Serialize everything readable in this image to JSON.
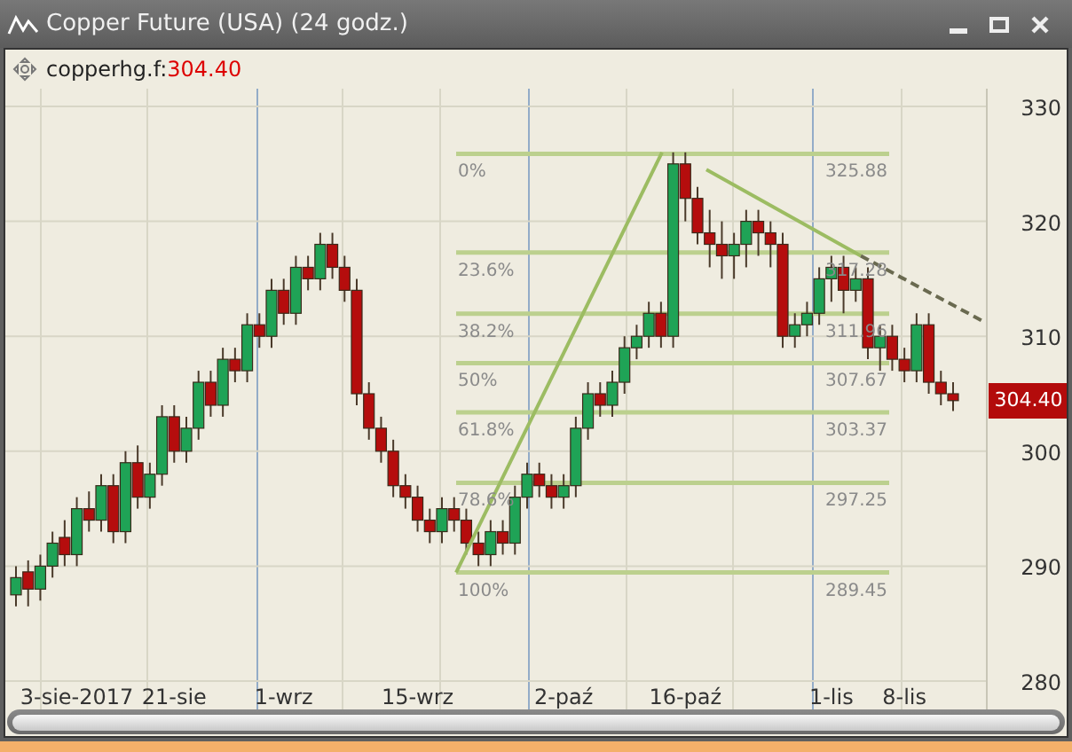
{
  "window": {
    "title": "Copper Future (USA) (24 godz.)"
  },
  "header": {
    "symbol": "copperhg.f:",
    "price": "304.40"
  },
  "chart_data": {
    "type": "candlestick",
    "categories": [
      null,
      null,
      null,
      null,
      null,
      "3-sie-2017",
      null,
      null,
      null,
      null,
      null,
      null,
      null,
      "21-sie",
      null,
      null,
      null,
      null,
      null,
      null,
      null,
      null,
      "1-wrz",
      null,
      null,
      null,
      null,
      null,
      null,
      null,
      null,
      null,
      null,
      "15-wrz",
      null,
      null,
      null,
      null,
      null,
      null,
      null,
      null,
      null,
      null,
      null,
      "2-paź",
      null,
      null,
      null,
      null,
      null,
      null,
      null,
      null,
      null,
      "16-paź",
      null,
      null,
      null,
      null,
      null,
      null,
      null,
      null,
      null,
      null,
      null,
      "1-lis",
      null,
      null,
      null,
      null,
      null,
      "8-lis",
      null,
      null,
      null,
      null
    ],
    "grid": true,
    "ohlc": [
      [
        287.5,
        290,
        286.5,
        289
      ],
      [
        289.5,
        290.5,
        286.5,
        288
      ],
      [
        288,
        291,
        287,
        290
      ],
      [
        290,
        293,
        289,
        292
      ],
      [
        292.5,
        294,
        290,
        291
      ],
      [
        291,
        296,
        290,
        295
      ],
      [
        295,
        296.5,
        293,
        294
      ],
      [
        294,
        298,
        293,
        297
      ],
      [
        297,
        298,
        292,
        293
      ],
      [
        293,
        300,
        292,
        299
      ],
      [
        299,
        300.5,
        295,
        296
      ],
      [
        296,
        299,
        295,
        298
      ],
      [
        298,
        304,
        297,
        303
      ],
      [
        303,
        304,
        299,
        300
      ],
      [
        300,
        303,
        299,
        302
      ],
      [
        302,
        307,
        301,
        306
      ],
      [
        306,
        307,
        303,
        304
      ],
      [
        304,
        309,
        303,
        308
      ],
      [
        308,
        309,
        306,
        307
      ],
      [
        307,
        312,
        306,
        311
      ],
      [
        311,
        312,
        309,
        310
      ],
      [
        310,
        315,
        309,
        314
      ],
      [
        314,
        315,
        311,
        312
      ],
      [
        312,
        317,
        311,
        316
      ],
      [
        316,
        317,
        314,
        315
      ],
      [
        315,
        319,
        314,
        318
      ],
      [
        318,
        319,
        315,
        316
      ],
      [
        316,
        317,
        313,
        314
      ],
      [
        314,
        315,
        304,
        305
      ],
      [
        305,
        306,
        301,
        302
      ],
      [
        302,
        303,
        299,
        300
      ],
      [
        300,
        301,
        296,
        297
      ],
      [
        297,
        298,
        295,
        296
      ],
      [
        296,
        297,
        293,
        294
      ],
      [
        294,
        295,
        292,
        293
      ],
      [
        293,
        296,
        292,
        295
      ],
      [
        295,
        296,
        293,
        294
      ],
      [
        294,
        295,
        291,
        292
      ],
      [
        292,
        293,
        290,
        291
      ],
      [
        291,
        294,
        290,
        293
      ],
      [
        293,
        294,
        291,
        292
      ],
      [
        292,
        297,
        291,
        296
      ],
      [
        296,
        299,
        295,
        298
      ],
      [
        298,
        299,
        296,
        297
      ],
      [
        297,
        298,
        295,
        296
      ],
      [
        296,
        298,
        295,
        297
      ],
      [
        297,
        303,
        296,
        302
      ],
      [
        302,
        306,
        301,
        305
      ],
      [
        305,
        306,
        303,
        304
      ],
      [
        304,
        307,
        303,
        306
      ],
      [
        306,
        310,
        305,
        309
      ],
      [
        309,
        311,
        308,
        310
      ],
      [
        310,
        313,
        309,
        312
      ],
      [
        312,
        313,
        309,
        310
      ],
      [
        310,
        326,
        309,
        325
      ],
      [
        325,
        326,
        320,
        322
      ],
      [
        322,
        323,
        318,
        319
      ],
      [
        319,
        321,
        316,
        318
      ],
      [
        318,
        320,
        315,
        317
      ],
      [
        317,
        319,
        315,
        318
      ],
      [
        318,
        321,
        316,
        320
      ],
      [
        320,
        321,
        317,
        319
      ],
      [
        319,
        320,
        316,
        318
      ],
      [
        318,
        319,
        309,
        310
      ],
      [
        310,
        312,
        309,
        311
      ],
      [
        311,
        313,
        310,
        312
      ],
      [
        312,
        316,
        311,
        315
      ],
      [
        315,
        317,
        313,
        316
      ],
      [
        316,
        317,
        312,
        314
      ],
      [
        314,
        316,
        313,
        315
      ],
      [
        315,
        316,
        308,
        309
      ],
      [
        309,
        311,
        307,
        310
      ],
      [
        310,
        311,
        307,
        308
      ],
      [
        308,
        309,
        306,
        307
      ],
      [
        307,
        312,
        306,
        311
      ],
      [
        311,
        312,
        305,
        306
      ],
      [
        306,
        307,
        304,
        305
      ],
      [
        305,
        306,
        303.5,
        304.4
      ]
    ],
    "yticks": [
      280,
      290,
      300,
      310,
      320,
      330
    ],
    "ylim": [
      280,
      330
    ]
  },
  "fibonacci": [
    {
      "label": "0%",
      "value": "325.88"
    },
    {
      "label": "23.6%",
      "value": "317.28"
    },
    {
      "label": "38.2%",
      "value": "311.96"
    },
    {
      "label": "50%",
      "value": "307.67"
    },
    {
      "label": "61.8%",
      "value": "303.37"
    },
    {
      "label": "78.6%",
      "value": "297.25"
    },
    {
      "label": "100%",
      "value": "289.45"
    }
  ],
  "last_price": "304.40"
}
